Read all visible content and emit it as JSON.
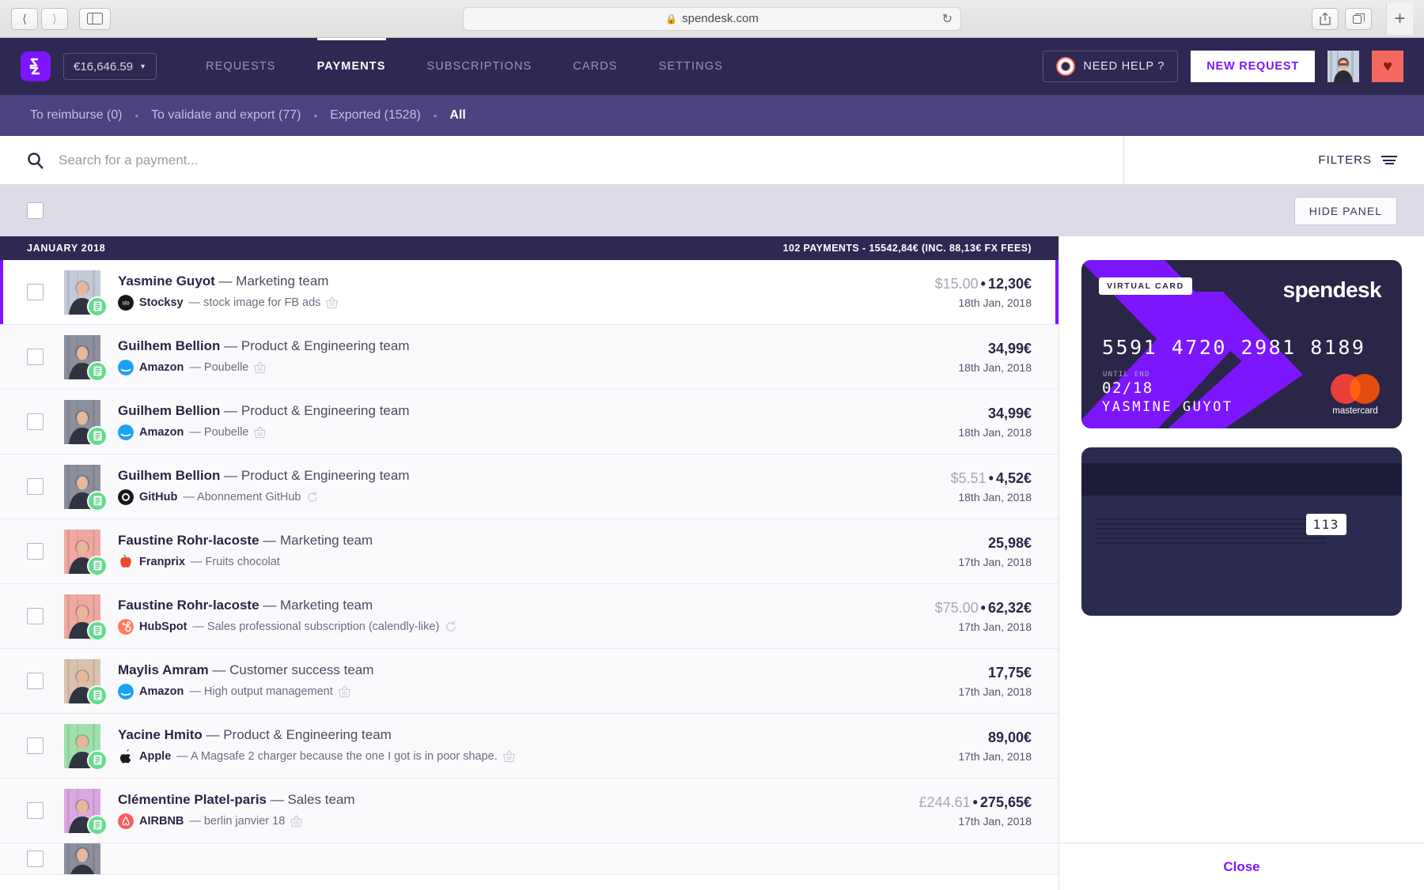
{
  "browser": {
    "url": "spendesk.com",
    "lock_icon": "lock-icon",
    "back_icon": "back-chevron-icon",
    "forward_icon": "forward-chevron-icon",
    "sidebar_icon": "sidebar-toggle-icon",
    "reload_icon": "reload-icon",
    "share_icon": "share-icon",
    "tabs_icon": "tab-overview-icon",
    "newtab_icon": "new-tab-plus-icon"
  },
  "header": {
    "logo_icon": "spendesk-logo-icon",
    "balance": "€16,646.59",
    "balance_caret": "chevron-down-icon",
    "nav": [
      {
        "label": "REQUESTS",
        "active": false
      },
      {
        "label": "PAYMENTS",
        "active": true
      },
      {
        "label": "SUBSCRIPTIONS",
        "active": false
      },
      {
        "label": "CARDS",
        "active": false
      },
      {
        "label": "SETTINGS",
        "active": false
      }
    ],
    "need_help": "NEED HELP ?",
    "need_help_icon": "lifebuoy-icon",
    "new_request": "NEW REQUEST",
    "avatar_icon": "user-avatar",
    "favorite_icon": "heart-icon"
  },
  "subnav": {
    "items": [
      {
        "label": "To reimburse (0)",
        "active": false
      },
      {
        "label": "To validate and export (77)",
        "active": false
      },
      {
        "label": "Exported (1528)",
        "active": false
      },
      {
        "label": "All",
        "active": true
      }
    ],
    "separator": "•"
  },
  "search": {
    "placeholder": "Search for a payment...",
    "value": "",
    "icon": "search-icon"
  },
  "filters": {
    "label": "FILTERS",
    "icon": "filter-icon"
  },
  "toolbar": {
    "select_all_checkbox": "select-all-checkbox",
    "hide_panel": "HIDE PANEL"
  },
  "month_group": {
    "title": "JANUARY 2018",
    "totals": "102 PAYMENTS - 15542,84€ (INC. 88,13€ FX FEES)"
  },
  "payments": [
    {
      "user": "Yasmine Guyot",
      "team": "Marketing team",
      "merchant": "Stocksy",
      "description": "stock image for FB ads",
      "merchant_icon": "stocksy-icon",
      "merchant_color": "#1f1f1f",
      "merchant_glyph": "S",
      "has_receipt_icon": true,
      "has_recurring_icon": false,
      "original_amount": "$15.00",
      "amount": "12,30€",
      "date": "18th Jan, 2018",
      "selected": true,
      "avatar_color": "#c4cbd8",
      "status_icon": "receipt-attached-icon"
    },
    {
      "user": "Guilhem Bellion",
      "team": "Product & Engineering team",
      "merchant": "Amazon",
      "description": "Poubelle",
      "merchant_icon": "amazon-icon",
      "merchant_color": "#1da1f2",
      "merchant_glyph": "a",
      "has_receipt_icon": true,
      "has_recurring_icon": false,
      "original_amount": "",
      "amount": "34,99€",
      "date": "18th Jan, 2018",
      "selected": false,
      "avatar_color": "#8c8f9e",
      "status_icon": "receipt-attached-icon"
    },
    {
      "user": "Guilhem Bellion",
      "team": "Product & Engineering team",
      "merchant": "Amazon",
      "description": "Poubelle",
      "merchant_icon": "amazon-icon",
      "merchant_color": "#1da1f2",
      "merchant_glyph": "a",
      "has_receipt_icon": true,
      "has_recurring_icon": false,
      "original_amount": "",
      "amount": "34,99€",
      "date": "18th Jan, 2018",
      "selected": false,
      "avatar_color": "#8c8f9e",
      "status_icon": "receipt-attached-icon"
    },
    {
      "user": "Guilhem Bellion",
      "team": "Product & Engineering team",
      "merchant": "GitHub",
      "description": "Abonnement GitHub",
      "merchant_icon": "github-icon",
      "merchant_color": "#161614",
      "merchant_glyph": "",
      "has_receipt_icon": false,
      "has_recurring_icon": true,
      "original_amount": "$5.51",
      "amount": "4,52€",
      "date": "18th Jan, 2018",
      "selected": false,
      "avatar_color": "#8c8f9e",
      "status_icon": "receipt-attached-icon"
    },
    {
      "user": "Faustine Rohr-lacoste",
      "team": "Marketing team",
      "merchant": "Franprix",
      "description": "Fruits chocolat",
      "merchant_icon": "franprix-apple-icon",
      "merchant_color": "#ffffff",
      "merchant_glyph": "🍎",
      "has_receipt_icon": false,
      "has_recurring_icon": false,
      "original_amount": "",
      "amount": "25,98€",
      "date": "17th Jan, 2018",
      "selected": false,
      "avatar_color": "#f0a9a0",
      "status_icon": "receipt-attached-icon"
    },
    {
      "user": "Faustine Rohr-lacoste",
      "team": "Marketing team",
      "merchant": "HubSpot",
      "description": "Sales professional subscription (calendly-like)",
      "merchant_icon": "hubspot-icon",
      "merchant_color": "#ff7a59",
      "merchant_glyph": "h",
      "has_receipt_icon": false,
      "has_recurring_icon": true,
      "original_amount": "$75.00",
      "amount": "62,32€",
      "date": "17th Jan, 2018",
      "selected": false,
      "avatar_color": "#f0a9a0",
      "status_icon": "receipt-attached-icon"
    },
    {
      "user": "Maylis Amram",
      "team": "Customer success team",
      "merchant": "Amazon",
      "description": "High output management",
      "merchant_icon": "amazon-icon",
      "merchant_color": "#1da1f2",
      "merchant_glyph": "a",
      "has_receipt_icon": true,
      "has_recurring_icon": false,
      "original_amount": "",
      "amount": "17,75€",
      "date": "17th Jan, 2018",
      "selected": false,
      "avatar_color": "#d9c3b0",
      "status_icon": "receipt-attached-icon"
    },
    {
      "user": "Yacine Hmito",
      "team": "Product & Engineering team",
      "merchant": "Apple",
      "description": "A Magsafe 2 charger because the one I got is in poor shape.",
      "merchant_icon": "apple-icon",
      "merchant_color": "#ffffff",
      "merchant_glyph": "",
      "has_receipt_icon": true,
      "has_recurring_icon": false,
      "original_amount": "",
      "amount": "89,00€",
      "date": "17th Jan, 2018",
      "selected": false,
      "avatar_color": "#9fe0ad",
      "status_icon": "receipt-attached-icon"
    },
    {
      "user": "Clémentine Platel-paris",
      "team": "Sales team",
      "merchant": "AIRBNB",
      "description": "berlin janvier 18",
      "merchant_icon": "airbnb-icon",
      "merchant_color": "#ff5a5f",
      "merchant_glyph": "",
      "has_receipt_icon": true,
      "has_recurring_icon": false,
      "original_amount": "£244.61",
      "amount": "275,65€",
      "date": "17th Jan, 2018",
      "selected": false,
      "avatar_color": "#d9a8e0",
      "status_icon": "receipt-attached-icon"
    }
  ],
  "card_panel": {
    "virtual_tag": "VIRTUAL CARD",
    "brand": "spendesk",
    "number": "5591 4720 2981 8189",
    "until_end_label": "UNTIL END",
    "expiry": "02/18",
    "holder": "YASMINE GUYOT",
    "network": "mastercard",
    "network_icon": "mastercard-icon",
    "cvv": "113",
    "close_label": "Close"
  }
}
